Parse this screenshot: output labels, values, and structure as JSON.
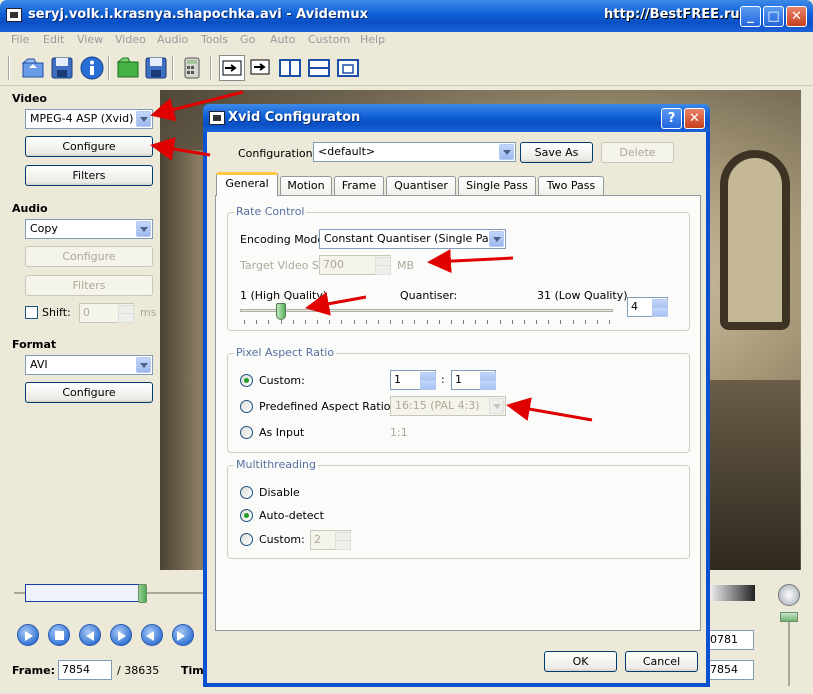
{
  "window": {
    "title": "seryj.volk.i.krasnya.shapochka.avi - Avidemux",
    "watermark": "http://BestFREE.ru"
  },
  "menu": [
    "File",
    "Edit",
    "View",
    "Video",
    "Audio",
    "Tools",
    "Go",
    "Auto",
    "Custom",
    "Help"
  ],
  "toolbar": {
    "icons": [
      "open-icon",
      "save-icon",
      "info-icon",
      "open-folder-icon",
      "save-as-icon",
      "calculator-icon",
      "view-output-icon",
      "view-input-icon",
      "view-side-icon",
      "view-top-icon",
      "view-single-icon"
    ]
  },
  "left": {
    "video_label": "Video",
    "video_codec": "MPEG-4 ASP (Xvid)",
    "video_configure": "Configure",
    "video_filters": "Filters",
    "audio_label": "Audio",
    "audio_codec": "Copy",
    "audio_configure": "Configure",
    "audio_filters": "Filters",
    "shift_label": "Shift:",
    "shift_value": "0",
    "shift_unit": "ms",
    "format_label": "Format",
    "format_value": "AVI",
    "format_configure": "Configure"
  },
  "status": {
    "frame_label": "Frame:",
    "frame_value": "7854",
    "frame_total": "/ 38635",
    "time_label": "Time",
    "right_value_1": "0781",
    "right_value_2": "7854"
  },
  "dialog": {
    "title": "Xvid Configuraton",
    "config_label": "Configuration:",
    "config_value": "<default>",
    "save_as": "Save As",
    "delete": "Delete",
    "tabs": [
      "General",
      "Motion",
      "Frame",
      "Quantiser",
      "Single Pass",
      "Two Pass"
    ],
    "rate_control": {
      "group": "Rate Control",
      "encoding_mode_label": "Encoding Mode:",
      "encoding_mode_value": "Constant Quantiser (Single Pass)",
      "target_size_label": "Target Video Size:",
      "target_size_value": "700",
      "target_size_unit": "MB",
      "high_quality": "1 (High Quality)",
      "quantiser_label": "Quantiser:",
      "low_quality": "31 (Low Quality)",
      "quantiser_value": "4",
      "slider_min": 1,
      "slider_max": 31,
      "slider_value": 4
    },
    "par": {
      "group": "Pixel Aspect Ratio",
      "custom_label": "Custom:",
      "custom_num": "1",
      "custom_sep": ":",
      "custom_den": "1",
      "predefined_label": "Predefined Aspect Ratio:",
      "predefined_value": "16:15 (PAL 4:3)",
      "as_input_label": "As Input",
      "as_input_value": "1:1",
      "selected": "Custom"
    },
    "mt": {
      "group": "Multithreading",
      "disable": "Disable",
      "auto_detect": "Auto-detect",
      "custom_label": "Custom:",
      "custom_value": "2",
      "selected": "Auto-detect"
    },
    "ok": "OK",
    "cancel": "Cancel"
  }
}
